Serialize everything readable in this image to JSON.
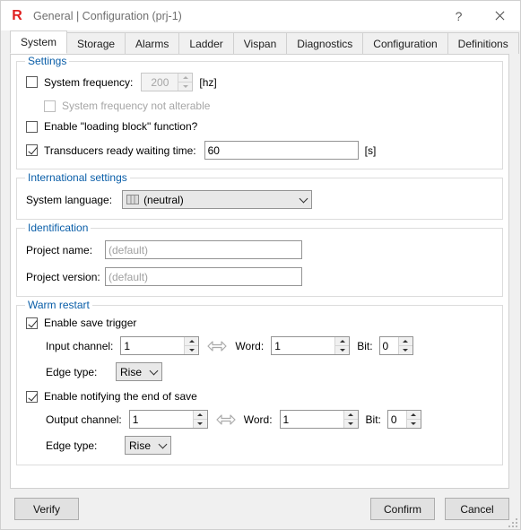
{
  "window": {
    "logo": "r-logo-icon",
    "title": "General | Configuration (prj-1)",
    "help_label": "?",
    "close_label": "close-icon"
  },
  "tabs": [
    {
      "label": "System",
      "active": true
    },
    {
      "label": "Storage",
      "active": false
    },
    {
      "label": "Alarms",
      "active": false
    },
    {
      "label": "Ladder",
      "active": false
    },
    {
      "label": "Vispan",
      "active": false
    },
    {
      "label": "Diagnostics",
      "active": false
    },
    {
      "label": "Configuration",
      "active": false
    },
    {
      "label": "Definitions",
      "active": false
    }
  ],
  "settings": {
    "legend": "Settings",
    "system_frequency": {
      "label": "System frequency:",
      "checked": false,
      "value": "200",
      "unit": "[hz]",
      "enabled": false
    },
    "not_alterable": {
      "label": "System frequency not alterable",
      "checked": false,
      "enabled": false
    },
    "loading_block": {
      "label": "Enable \"loading block\" function?",
      "checked": false
    },
    "transducers": {
      "label": "Transducers ready waiting time:",
      "checked": true,
      "value": "60",
      "unit": "[s]"
    }
  },
  "international": {
    "legend": "International settings",
    "language_label": "System language:",
    "language_value": "(neutral)",
    "language_icon": "flag-icon"
  },
  "identification": {
    "legend": "Identification",
    "project_name_label": "Project name:",
    "project_name_placeholder": "(default)",
    "project_name_value": "",
    "project_version_label": "Project version:",
    "project_version_placeholder": "(default)",
    "project_version_value": ""
  },
  "warm_restart": {
    "legend": "Warm restart",
    "save_trigger": {
      "label": "Enable save trigger",
      "checked": true,
      "channel_label": "Input channel:",
      "channel_value": "1",
      "word_label": "Word:",
      "word_value": "1",
      "bit_label": "Bit:",
      "bit_value": "0",
      "edge_label": "Edge type:",
      "edge_value": "Rise"
    },
    "notify_end": {
      "label": "Enable notifying the end of save",
      "checked": true,
      "channel_label": "Output channel:",
      "channel_value": "1",
      "word_label": "Word:",
      "word_value": "1",
      "bit_label": "Bit:",
      "bit_value": "0",
      "edge_label": "Edge type:",
      "edge_value": "Rise"
    }
  },
  "footer": {
    "verify_label": "Verify",
    "confirm_label": "Confirm",
    "cancel_label": "Cancel"
  },
  "colors": {
    "legend_blue": "#0a5ea8",
    "logo_red": "#e02020",
    "window_bg": "#f0f0f0",
    "panel_bg": "#ffffff"
  }
}
